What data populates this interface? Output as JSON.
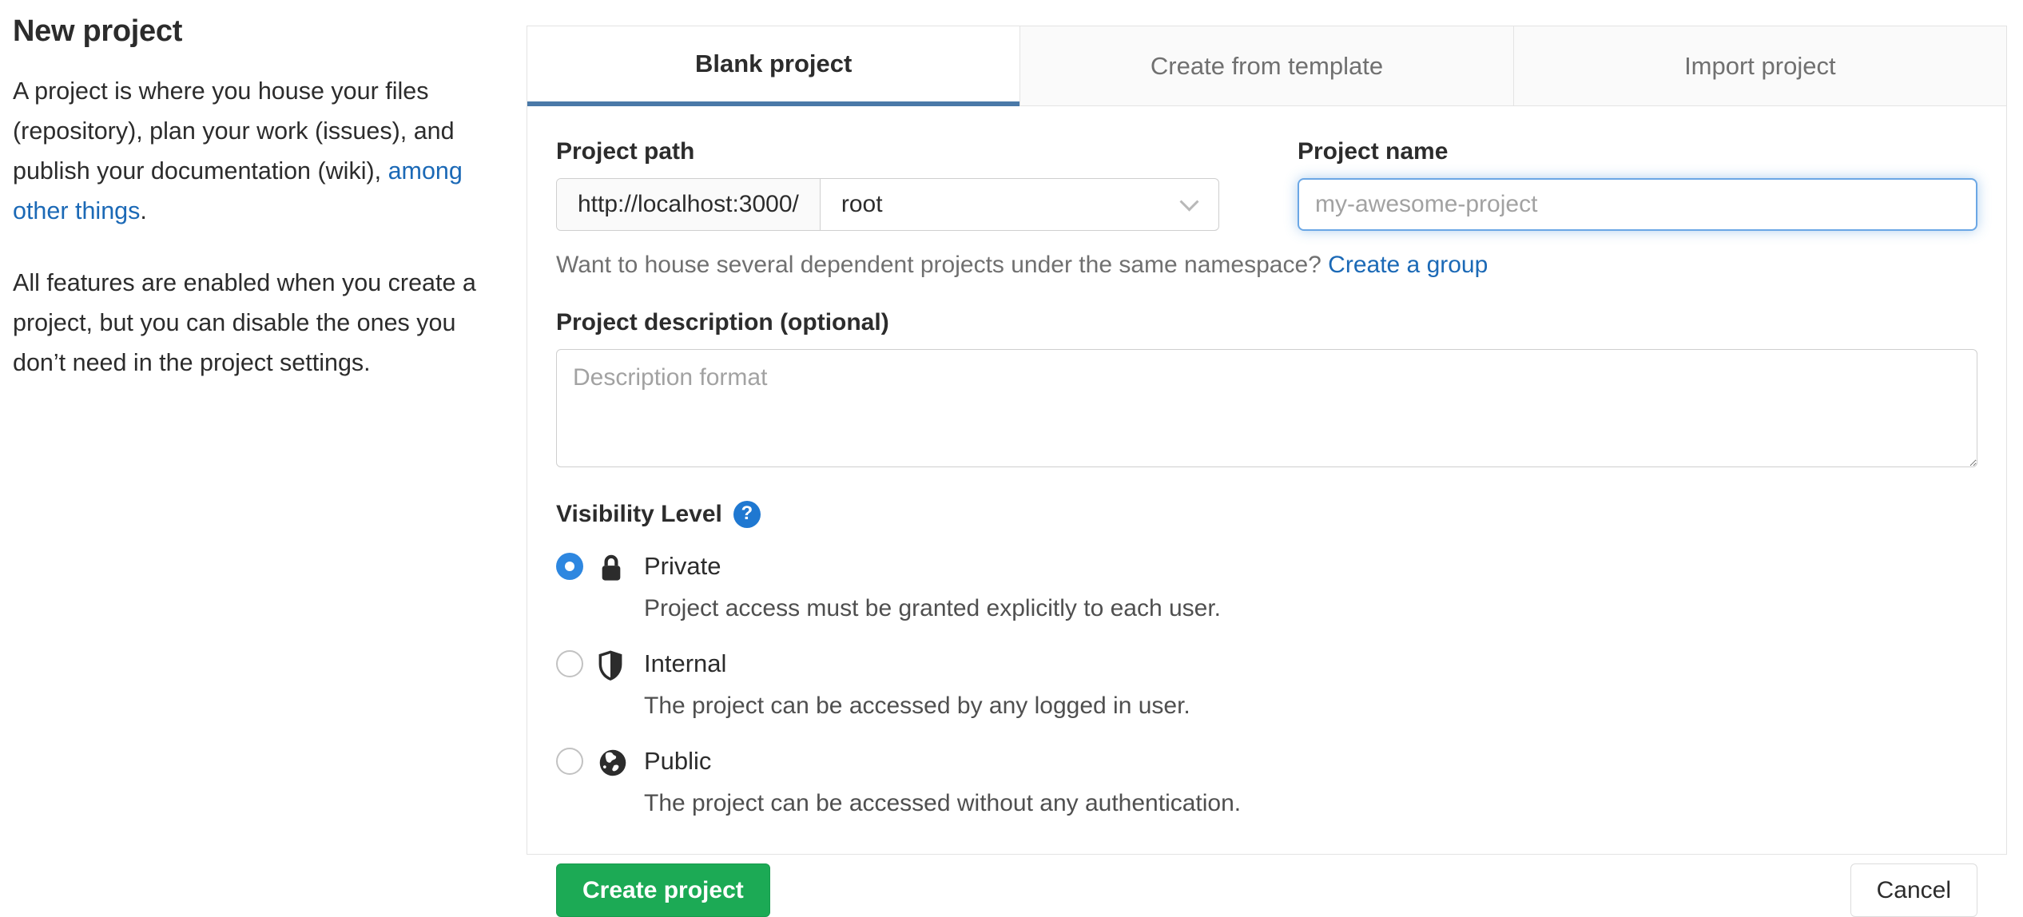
{
  "sidebar": {
    "title": "New project",
    "para1_before": "A project is where you house your files (repository), plan your work (issues), and publish your documentation (wiki),",
    "para1_link": "among other things",
    "para1_after": ".",
    "para2": "All features are enabled when you create a project, but you can disable the ones you don’t need in the project settings."
  },
  "tabs": [
    {
      "label": "Blank project",
      "active": true
    },
    {
      "label": "Create from template",
      "active": false
    },
    {
      "label": "Import project",
      "active": false
    }
  ],
  "form": {
    "project_path": {
      "label": "Project path",
      "url_prefix": "http://localhost:3000/",
      "namespace_selected": "root"
    },
    "project_name": {
      "label": "Project name",
      "placeholder": "my-awesome-project",
      "value": ""
    },
    "namespace_hint": {
      "text": "Want to house several dependent projects under the same namespace?",
      "link": "Create a group"
    },
    "description": {
      "label": "Project description (optional)",
      "placeholder": "Description format",
      "value": ""
    },
    "visibility": {
      "label": "Visibility Level",
      "help_symbol": "?",
      "options": [
        {
          "name": "Private",
          "description": "Project access must be granted explicitly to each user.",
          "selected": true,
          "icon": "lock-icon"
        },
        {
          "name": "Internal",
          "description": "The project can be accessed by any logged in user.",
          "selected": false,
          "icon": "shield-icon"
        },
        {
          "name": "Public",
          "description": "The project can be accessed without any authentication.",
          "selected": false,
          "icon": "globe-icon"
        }
      ]
    },
    "submit_label": "Create project",
    "cancel_label": "Cancel"
  },
  "colors": {
    "link_blue": "#1b69b6",
    "accent_blue": "#1f78d1",
    "tab_underline": "#4a79a8",
    "radio_selected": "#2e87e0",
    "button_green": "#1caa55"
  }
}
